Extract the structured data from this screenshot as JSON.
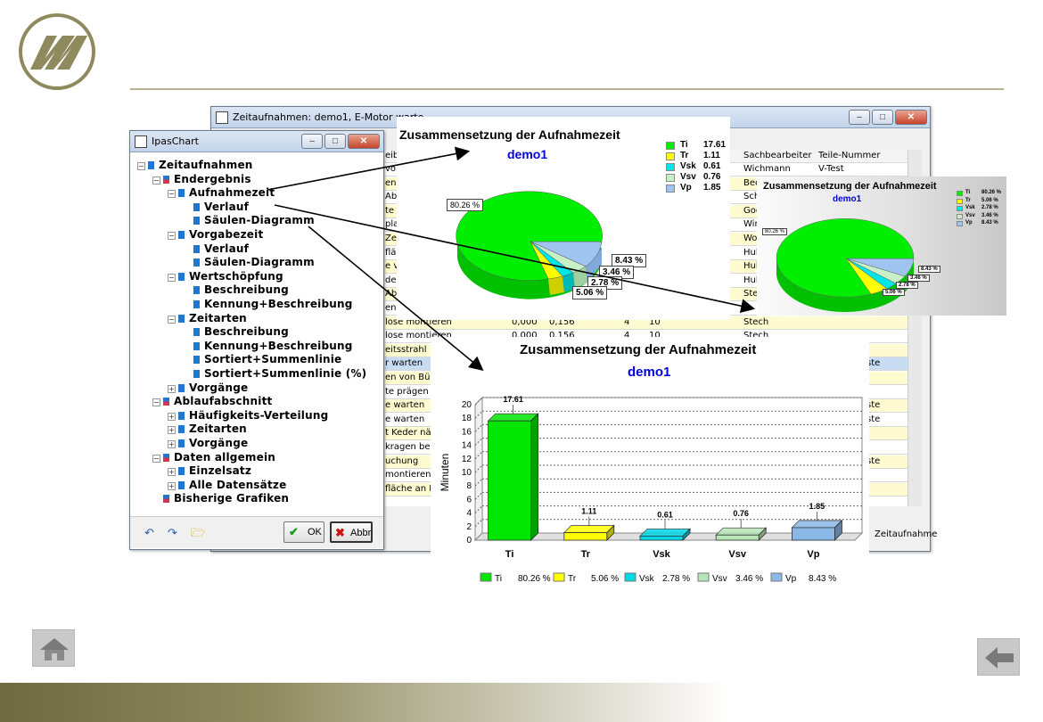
{
  "tree_window": {
    "title": "IpasChart",
    "items": [
      {
        "label": "Zeitaufnahmen",
        "level": 0,
        "toggle": "-"
      },
      {
        "label": "Endergebnis",
        "level": 1,
        "toggle": "-"
      },
      {
        "label": "Aufnahmezeit",
        "level": 2,
        "toggle": "-"
      },
      {
        "label": "Verlauf",
        "level": 3,
        "toggle": ""
      },
      {
        "label": "Säulen-Diagramm",
        "level": 3,
        "toggle": ""
      },
      {
        "label": "Vorgabezeit",
        "level": 2,
        "toggle": "-"
      },
      {
        "label": "Verlauf",
        "level": 3,
        "toggle": ""
      },
      {
        "label": "Säulen-Diagramm",
        "level": 3,
        "toggle": ""
      },
      {
        "label": "Wertschöpfung",
        "level": 2,
        "toggle": "-"
      },
      {
        "label": "Beschreibung",
        "level": 3,
        "toggle": ""
      },
      {
        "label": "Kennung+Beschreibung",
        "level": 3,
        "toggle": ""
      },
      {
        "label": "Zeitarten",
        "level": 2,
        "toggle": "-"
      },
      {
        "label": "Beschreibung",
        "level": 3,
        "toggle": ""
      },
      {
        "label": "Kennung+Beschreibung",
        "level": 3,
        "toggle": ""
      },
      {
        "label": "Sortiert+Summenlinie",
        "level": 3,
        "toggle": ""
      },
      {
        "label": "Sortiert+Summenlinie (%)",
        "level": 3,
        "toggle": ""
      },
      {
        "label": "Vorgänge",
        "level": 2,
        "toggle": "+"
      },
      {
        "label": "Ablaufabschnitt",
        "level": 1,
        "toggle": "-"
      },
      {
        "label": "Häufigkeits-Verteilung",
        "level": 2,
        "toggle": "+"
      },
      {
        "label": "Zeitarten",
        "level": 2,
        "toggle": "+"
      },
      {
        "label": "Vorgänge",
        "level": 2,
        "toggle": "+"
      },
      {
        "label": "Daten allgemein",
        "level": 1,
        "toggle": "-"
      },
      {
        "label": "Einzelsatz",
        "level": 2,
        "toggle": "+"
      },
      {
        "label": "Alle Datensätze",
        "level": 2,
        "toggle": "+"
      },
      {
        "label": "Bisherige Grafiken",
        "level": 1,
        "toggle": ""
      }
    ],
    "ok_label": "OK",
    "cancel_label": "Abbr"
  },
  "table_window": {
    "title": "Zeitaufnahmen: demo1, E-Motor warte",
    "headers": [
      "Sachbearbeiter",
      "Teile-Nummer"
    ],
    "status_label": "Zeitaufnahme",
    "rows": [
      {
        "c1": "vo",
        "c5": "Wichmann",
        "c6": "V-Test",
        "hl": false
      },
      {
        "c1": "en v",
        "c5": "Bec",
        "hl": true
      },
      {
        "c1": "Abc",
        "c5": "Sch",
        "hl": false
      },
      {
        "c1": "te p",
        "c5": "Goe",
        "hl": true
      },
      {
        "c1": "plat",
        "c5": "Wir",
        "hl": false
      },
      {
        "c1": "Ze",
        "c5": "Wo",
        "hl": true
      },
      {
        "c1": "fläc",
        "c5": "Hub",
        "hl": false
      },
      {
        "c1": "e vo",
        "c5": "Hub",
        "hl": true
      },
      {
        "c1": "der",
        "c5": "Hub",
        "hl": false
      },
      {
        "c1": "Ab",
        "c5": "Ste",
        "hl": true
      },
      {
        "c1": "en E",
        "c5": "",
        "hl": false
      },
      {
        "c1": "lose montieren",
        "c2": "0,000",
        "c3": "0,156",
        "c4": "4",
        "c4b": "10",
        "c5": "Stech",
        "hl": true
      },
      {
        "c1": "lose montieren",
        "c2": "0,000",
        "c3": "0,156",
        "c4": "4",
        "c4b": "10",
        "c5": "Stech",
        "hl": false
      },
      {
        "c1": "eitsstrahl",
        "c5": "",
        "hl": true
      },
      {
        "c1": "r warten",
        "c5": "",
        "c7": "ste",
        "hl": false,
        "sel": true
      },
      {
        "c1": "en von Büron",
        "c5": "",
        "hl": true
      },
      {
        "c1": "te prägen ar",
        "c5": "",
        "hl": false
      },
      {
        "c1": "e warten",
        "c5": "",
        "c7": "ste",
        "hl": true
      },
      {
        "c1": "e warten",
        "c5": "",
        "c7": "ste",
        "hl": false
      },
      {
        "c1": "t Keder nähe",
        "c5": "",
        "hl": true
      },
      {
        "c1": "kragen bearb",
        "c5": "",
        "hl": false
      },
      {
        "c1": "uchung",
        "c5": "",
        "c7": "ste",
        "hl": true
      },
      {
        "c1": "montieren",
        "c5": "",
        "hl": false
      },
      {
        "c1": "fläche an Kle",
        "c5": "",
        "hl": true
      }
    ]
  },
  "pie_chart": {
    "title": "Zusammensetzung der Aufnahmezeit",
    "subtitle": "demo1",
    "legend": [
      {
        "key": "Ti",
        "value": "17.61",
        "color": "#00ee00"
      },
      {
        "key": "Tr",
        "value": "1.11",
        "color": "#ffff00"
      },
      {
        "key": "Vsk",
        "value": "0.61",
        "color": "#00e5e5"
      },
      {
        "key": "Vsv",
        "value": "0.76",
        "color": "#c8f0c8"
      },
      {
        "key": "Vp",
        "value": "1.85",
        "color": "#a0c4f0"
      }
    ],
    "labels": [
      "80.26 %",
      "8.43 %",
      "3.46 %",
      "2.78 %",
      "5.06 %"
    ]
  },
  "pie_chart_small": {
    "title": "Zusammensetzung der Aufnahmezeit",
    "subtitle": "demo1",
    "legend": [
      {
        "key": "Ti",
        "value": "80.26 %"
      },
      {
        "key": "Tr",
        "value": "5.06 %"
      },
      {
        "key": "Vsk",
        "value": "2.78 %"
      },
      {
        "key": "Vsv",
        "value": "3.46 %"
      },
      {
        "key": "Vp",
        "value": "8.43 %"
      }
    ],
    "labels": [
      "80.26 %",
      "8.43 %",
      "3.46 %",
      "2.78 %",
      "5.06 %"
    ]
  },
  "chart_data": {
    "type": "bar",
    "title": "Zusammensetzung der Aufnahmezeit",
    "subtitle": "demo1",
    "categories": [
      "Ti",
      "Tr",
      "Vsk",
      "Vsv",
      "Vp"
    ],
    "values": [
      17.61,
      1.11,
      0.61,
      0.76,
      1.85
    ],
    "value_labels": [
      "17.61",
      "1.11",
      "0.61",
      "0.76",
      "1.85"
    ],
    "colors": [
      "#00e600",
      "#ffff00",
      "#00d8e8",
      "#b8e6b8",
      "#8ab8e8"
    ],
    "ylabel": "Minuten",
    "xlabel": "",
    "ylim": [
      0,
      20
    ],
    "yticks": [
      "0",
      "2",
      "4",
      "6",
      "8",
      "10",
      "12",
      "14",
      "16",
      "18",
      "20"
    ],
    "legend": [
      {
        "key": "Ti",
        "pct": "80.26 %"
      },
      {
        "key": "Tr",
        "pct": "5.06 %"
      },
      {
        "key": "Vsk",
        "pct": "2.78 %"
      },
      {
        "key": "Vsv",
        "pct": "3.46 %"
      },
      {
        "key": "Vp",
        "pct": "8.43 %"
      }
    ],
    "grid": true,
    "legend_position": "bottom"
  }
}
